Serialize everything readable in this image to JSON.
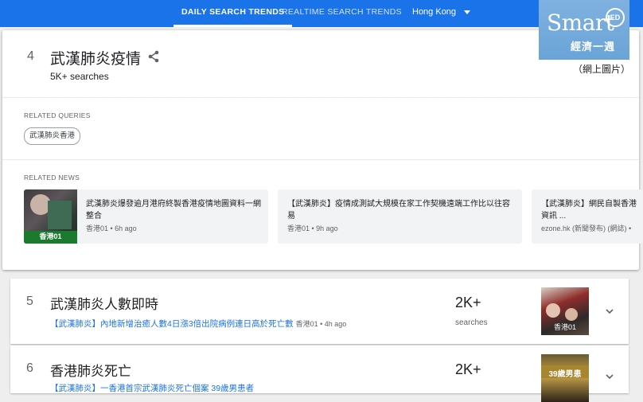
{
  "topbar": {
    "tabs": [
      {
        "label": "DAILY SEARCH TRENDS",
        "active": true
      },
      {
        "label": "REALTIME SEARCH TRENDS",
        "active": false
      }
    ],
    "region": "Hong Kong",
    "accent": "#1a73e8"
  },
  "logo": {
    "brand": "Smart",
    "badge": "ED",
    "sub": "經濟一週"
  },
  "caption": "（網上圖片）",
  "expanded": {
    "rank": "4",
    "title": "武漢肺炎疫情",
    "searches": "5K+ searches",
    "related_queries_label": "RELATED QUERIES",
    "related_queries": [
      "武漢肺炎香港"
    ],
    "related_news_label": "RELATED NEWS",
    "news": [
      {
        "title": "武漢肺炎爆發逾月港府終製香港疫情地圖資料一網整合",
        "source": "香港01 • 6h ago",
        "thumb_tag": "香港01"
      },
      {
        "title": "【武漢肺炎】疫情成測試大規模在家工作契機遠端工作比以往容易",
        "source": "香港01 • 9h ago"
      },
      {
        "title": "【武漢肺炎】網民自製香港 資訊 ...",
        "source": "ezone.hk (新聞發布) (網誌) •"
      }
    ]
  },
  "items": [
    {
      "rank": "5",
      "title": "武漢肺炎人數即時",
      "link": "【武漢肺炎】內地新增治癒人數4日漲3倍出院病例連日高於死亡數",
      "link_meta": "香港01 • 4h ago",
      "count": "2K+",
      "count_label": "searches",
      "thumb_tag": "香港01"
    },
    {
      "rank": "6",
      "title": "香港肺炎死亡",
      "link": "【武漢肺炎】一香港首宗武漢肺炎死亡個案 39歲男患者",
      "link_meta": "",
      "count": "2K+",
      "count_label": "",
      "thumb_tag": "39歲男患"
    }
  ]
}
